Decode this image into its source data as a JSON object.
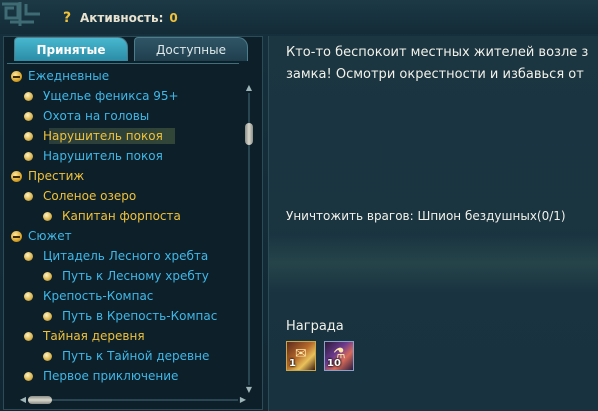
{
  "activity": {
    "label": "Активность:",
    "value": "0"
  },
  "tabs": {
    "accepted": "Принятые",
    "available": "Доступные"
  },
  "quests": [
    {
      "type": "cat",
      "label": "Ежедневные",
      "color": "blue"
    },
    {
      "type": "lvl1",
      "label": "Ущелье феникса 95+",
      "color": "blue"
    },
    {
      "type": "lvl1",
      "label": "Охота на головы",
      "color": "blue"
    },
    {
      "type": "lvl1",
      "label": "Нарушитель покоя",
      "color": "gold",
      "selected": true
    },
    {
      "type": "lvl1",
      "label": "Нарушитель покоя",
      "color": "blue"
    },
    {
      "type": "cat",
      "label": "Престиж",
      "color": "gold"
    },
    {
      "type": "lvl1",
      "label": "Соленое озеро",
      "color": "gold"
    },
    {
      "type": "lvl2",
      "label": "Капитан форпоста",
      "color": "gold"
    },
    {
      "type": "cat",
      "label": "Сюжет",
      "color": "blue"
    },
    {
      "type": "lvl1",
      "label": "Цитадель Лесного хребта",
      "color": "blue"
    },
    {
      "type": "lvl2",
      "label": "Путь к Лесному хребту",
      "color": "blue"
    },
    {
      "type": "lvl1",
      "label": "Крепость-Компас",
      "color": "blue"
    },
    {
      "type": "lvl2",
      "label": "Путь в Крепость-Компас",
      "color": "blue"
    },
    {
      "type": "lvl1",
      "label": "Тайная деревня",
      "color": "gold"
    },
    {
      "type": "lvl2",
      "label": "Путь к Тайной деревне",
      "color": "blue"
    },
    {
      "type": "lvl1",
      "label": "Первое приключение",
      "color": "blue"
    }
  ],
  "details": {
    "description": "Кто-то беспокоит местных жителей возле з\nзамка! Осмотри окрестности и избавься от",
    "objective": "Уничтожить врагов: Шпион бездушных(0/1)",
    "reward_title": "Награда",
    "rewards": [
      {
        "icon": "scroll-reward-icon",
        "qty": "1"
      },
      {
        "icon": "potion-reward-icon",
        "qty": "10"
      }
    ]
  },
  "colors": {
    "blue": "#3fb8e8",
    "gold": "#f0c23a",
    "text": "#f2f2ea"
  }
}
